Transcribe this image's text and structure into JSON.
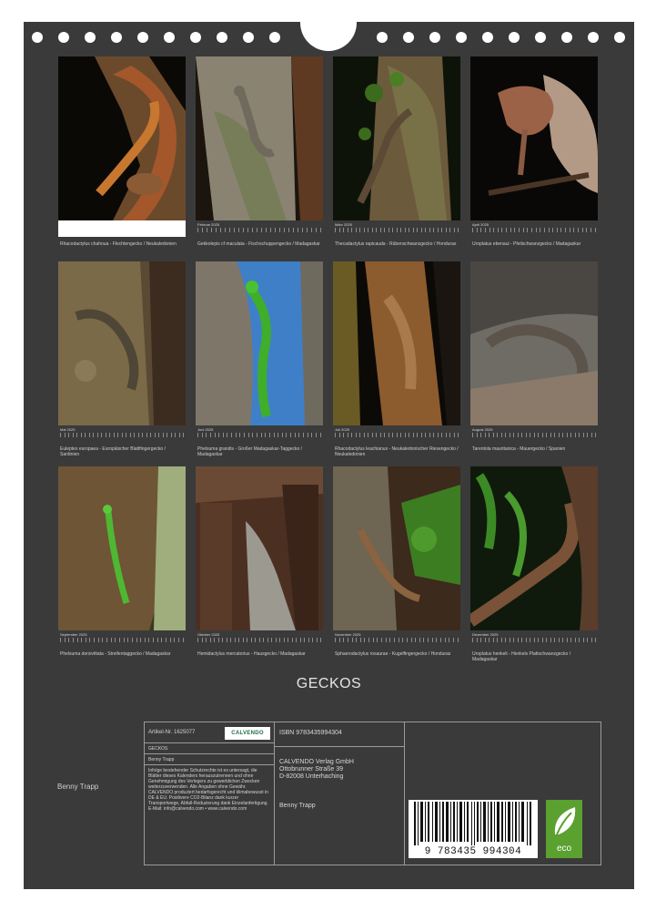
{
  "calendar": {
    "title": "GECKOS",
    "author": "Benny Trapp",
    "months": [
      {
        "month": "",
        "caption": "Rhacodactylus chahoua - Flechtengecko / Neukaledonien"
      },
      {
        "month": "Februar 2025",
        "caption": "Gekkolepis cf maculata - Fischschuppengecko / Madagaskar"
      },
      {
        "month": "März 2025",
        "caption": "Thecadactylus rapicauda - Rübenschwanzgecko / Honduras"
      },
      {
        "month": "April 2025",
        "caption": "Uroplatus ebenaui - Pfeilschwanzgecko / Madagaskar"
      },
      {
        "month": "Mai 2025",
        "caption": "Euleptes europaea - Europäischer Blattfingergecko / Sardinien"
      },
      {
        "month": "Juni 2025",
        "caption": "Phelsuma grandis - Großer Madagaskar-Taggecko / Madagaskar"
      },
      {
        "month": "Juli 2025",
        "caption": "Rhacodactylus leachianus - Neukaledonischer Riesengecko / Neukaledonien"
      },
      {
        "month": "August 2025",
        "caption": "Tarentola mauritanica - Mauergecko / Spanien"
      },
      {
        "month": "September 2025",
        "caption": "Phelsuma dorsivittata - Streifentaggecko / Madagaskar"
      },
      {
        "month": "Oktober 2025",
        "caption": "Hemidactylus mercatorius - Hausgecko / Madagaskar"
      },
      {
        "month": "November 2025",
        "caption": "Sphaerodactylus rosaurae - Kugelfingergecko / Honduras"
      },
      {
        "month": "Dezember 2025",
        "caption": "Uroplatus henkeli - Henkels Plattschwanzgecko / Madagaskar"
      }
    ]
  },
  "info": {
    "article_nr": "Artikel-Nr. 1625077",
    "calvendo_logo": "CALVENDO",
    "title_small": "GECKOS",
    "author_small": "Benny Trapp",
    "legal_text": "Infolge bestehender Schutzrechte ist es untersagt, die Blätter dieses Kalenders herauszutrennen und ohne Genehmigung des Verlegers zu gewerblichen Zwecken weiterzuverwenden. Alle Angaben ohne Gewähr. CALVENDO produziert bedarfsgerecht und klimabewusst in DE & EU. Positivere CO2-Bilanz dank kurzer Transportwege, Abfall-Reduzierung dank Einzelanfertigung. E-Mail: info@calvendo.com • www.calvendo.com",
    "isbn": "ISBN 9783435994304",
    "publisher": "CALVENDO Verlag GmbH",
    "street": "Ottobrunner Straße 39",
    "city": "D-82008 Unterhaching",
    "author_right": "Benny Trapp",
    "barcode_number": "9 783435 994304",
    "eco_label": "eco"
  },
  "colors": {
    "background": "#3a3a3a",
    "eco": "#5aa12f"
  }
}
